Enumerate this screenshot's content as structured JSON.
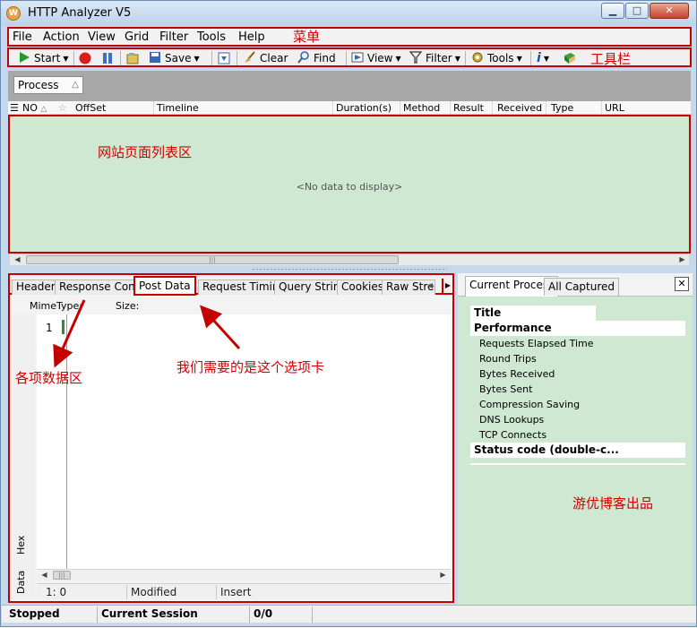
{
  "window": {
    "title": "HTTP Analyzer V5",
    "app_icon": "W"
  },
  "window_buttons": {
    "minimize": "▁",
    "maximize": "□",
    "close": "✕"
  },
  "menu": [
    "File",
    "Action",
    "View",
    "Grid",
    "Filter",
    "Tools",
    "Help"
  ],
  "toolbar": {
    "start": "Start",
    "save": "Save",
    "clear": "Clear",
    "find": "Find",
    "view": "View",
    "filter": "Filter",
    "tools": "Tools"
  },
  "group_area": {
    "chip": "Process",
    "sort": "△"
  },
  "grid": {
    "columns": [
      "NO",
      "OffSet",
      "Timeline",
      "Duration(s)",
      "Method",
      "Result",
      "Received",
      "Type",
      "URL"
    ],
    "empty_text": "<No data to display>"
  },
  "detail_tabs": [
    "Header",
    "Response Content",
    "Post Data",
    "Request Timing",
    "Query String",
    "Cookies",
    "Raw Stre"
  ],
  "active_detail_tab": "Post Data",
  "editor": {
    "mime_label": "MimeType:",
    "size_label": "Size:",
    "line_number": "1",
    "side_tabs": [
      "Hex",
      "Data"
    ],
    "status": {
      "position": "1: 0",
      "modified": "Modified",
      "insert": "Insert"
    }
  },
  "right_panel": {
    "tabs": [
      "Current Process",
      "All Captured"
    ],
    "close": "✕",
    "properties": [
      {
        "label": "Title",
        "kind": "head"
      },
      {
        "label": "Performance",
        "kind": "head"
      },
      {
        "label": "Requests Elapsed Time",
        "kind": "item"
      },
      {
        "label": "Round Trips",
        "kind": "item"
      },
      {
        "label": "Bytes Received",
        "kind": "item"
      },
      {
        "label": "Bytes Sent",
        "kind": "item"
      },
      {
        "label": "Compression Saving",
        "kind": "item"
      },
      {
        "label": "DNS Lookups",
        "kind": "item"
      },
      {
        "label": "TCP Connects",
        "kind": "item"
      },
      {
        "label": "Status code (double-c...",
        "kind": "head"
      }
    ]
  },
  "statusbar": {
    "state": "Stopped",
    "session": "Current Session",
    "count": "0/0"
  },
  "annotations": {
    "menu": "菜单",
    "toolbar": "工具栏",
    "list": "网站页面列表区",
    "data": "各项数据区",
    "tab_hint": "我们需要的是这个选项卡",
    "credit": "游优博客出品"
  },
  "colors": {
    "annotation": "#d20000",
    "highlight_box": "#c40000",
    "panel_green": "#cfe8d2"
  }
}
